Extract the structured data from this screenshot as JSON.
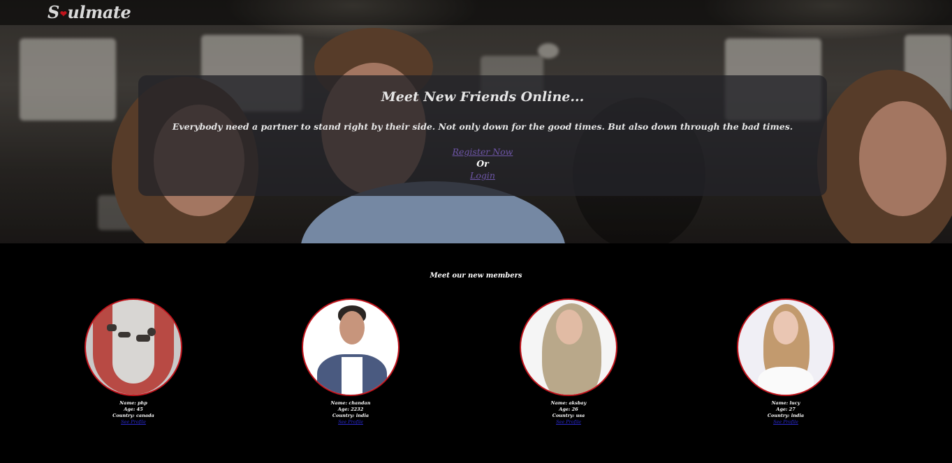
{
  "brand": {
    "logo_text_before": "S",
    "logo_text_after": "ulmate",
    "accent_color": "#c0141c"
  },
  "hero": {
    "title": "Meet New Friends Online...",
    "subtitle": "Everybody need a partner to stand right by their side. Not only down for the good times. But also down through the bad times.",
    "register_label": "Register Now",
    "or_label": "Or",
    "login_label": "Login"
  },
  "members": {
    "heading": "Meet our new members",
    "items": [
      {
        "name": "Name: php",
        "age": "Age: 45",
        "country": "Country: canada",
        "link": "See Profile"
      },
      {
        "name": "Name: chandan",
        "age": "Age: 2232",
        "country": "Country: india",
        "link": "See Profile"
      },
      {
        "name": "Name: aksbay",
        "age": "Age: 26",
        "country": "Country: usa",
        "link": "See Profile"
      },
      {
        "name": "Name: lucy",
        "age": "Age: 27",
        "country": "Country: india",
        "link": "See Profile"
      }
    ]
  }
}
